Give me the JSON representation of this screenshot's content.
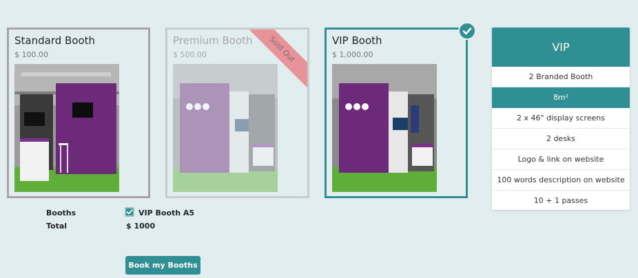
{
  "booths": [
    {
      "title": "Standard Booth",
      "price": "$ 100.00"
    },
    {
      "title": "Premium Booth",
      "price": "$ 500.00",
      "ribbon": "Sold Out"
    },
    {
      "title": "VIP Booth",
      "price": "$ 1,000.00",
      "selected": true
    }
  ],
  "summary": {
    "booths_label": "Booths",
    "total_label": "Total",
    "selected_booth": "VIP Booth A5",
    "total_value": "$ 1000"
  },
  "book_button": "Book my Booths",
  "plan": {
    "name": "VIP",
    "features": [
      "2 Branded Booth",
      "8m²",
      "2 x 46\" display screens",
      "2 desks",
      "Logo & link on website",
      "100 words description on website",
      "10 + 1 passes"
    ]
  },
  "colors": {
    "accent": "#2f8f93",
    "background": "#e2edef",
    "sold_out_ribbon": "#e8939a"
  },
  "icons": [
    "check-circle-icon",
    "checkbox-checked-icon"
  ]
}
